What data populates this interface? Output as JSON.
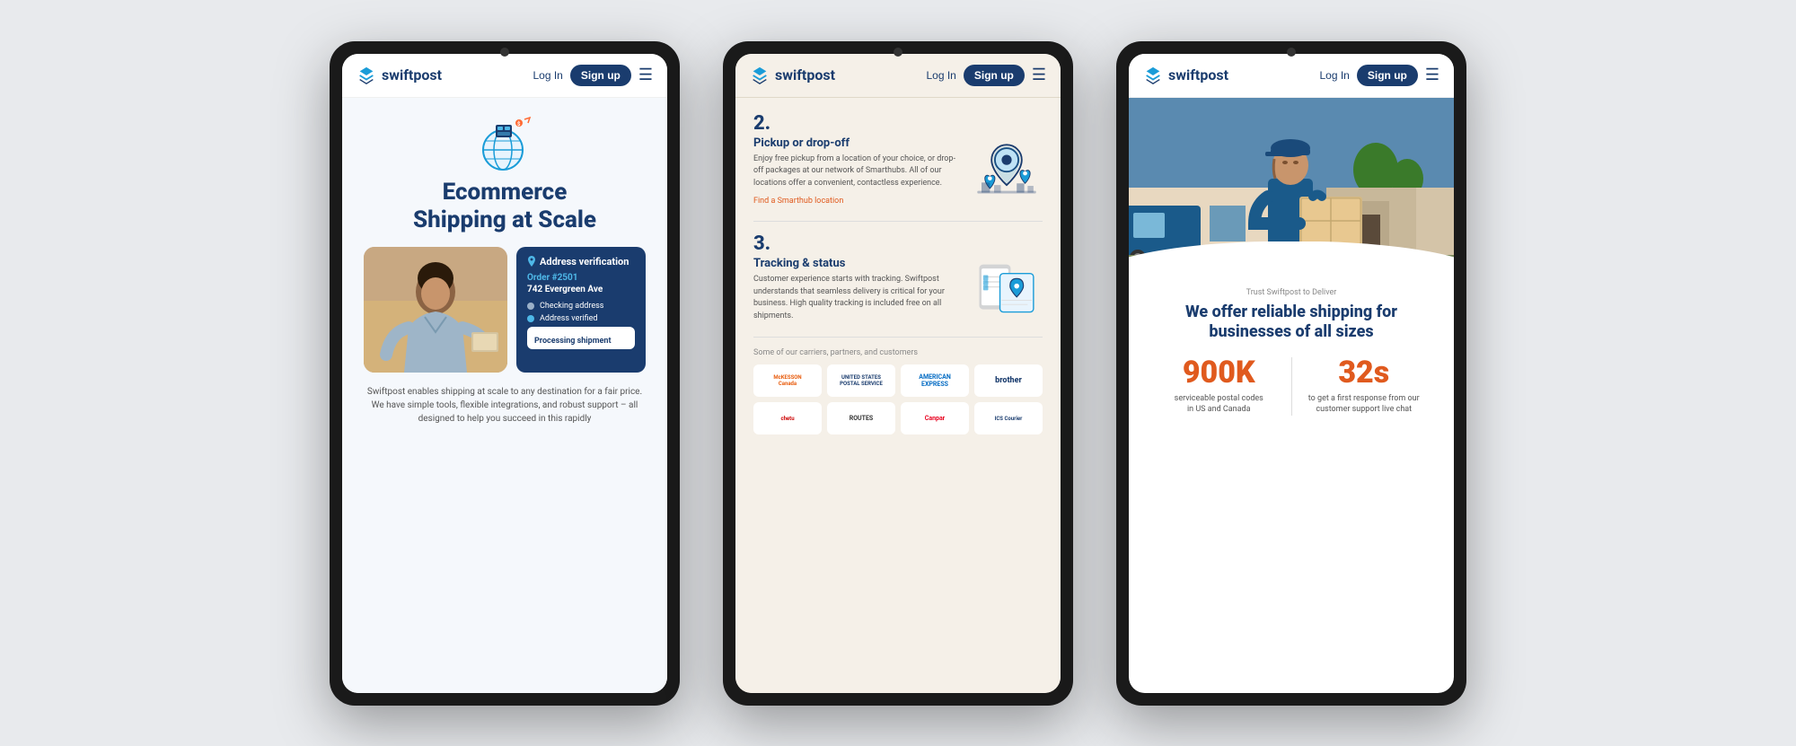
{
  "page": {
    "bg_color": "#e8eaed"
  },
  "tablet1": {
    "nav": {
      "logo_text": "swiftpost",
      "login": "Log In",
      "signup": "Sign up"
    },
    "hero": {
      "title_line1": "Ecommerce",
      "title_line2": "Shipping at Scale"
    },
    "address_card": {
      "title": "Address verification",
      "order": "Order #2501",
      "street": "742 Evergreen Ave",
      "step1": "Checking address",
      "step2": "Address verified",
      "step3": "Processing shipment"
    },
    "description": "Swiftpost enables shipping at scale to any destination for a fair price. We have simple tools, flexible integrations, and robust support – all designed to help you succeed in this rapidly"
  },
  "tablet2": {
    "nav": {
      "logo_text": "swiftpost",
      "login": "Log In",
      "signup": "Sign up"
    },
    "section2": {
      "number": "2.",
      "title": "Pickup or drop-off",
      "description": "Enjoy free pickup from a location of your choice, or drop-off packages at our network of Smarthubs. All of our locations offer a convenient, contactless experience.",
      "link": "Find a Smarthub location"
    },
    "section3": {
      "number": "3.",
      "title": "Tracking & status",
      "description": "Customer experience starts with tracking. Swiftpost understands that seamless delivery is critical for your business. High quality tracking is included free on all shipments."
    },
    "partners": {
      "label": "Some of our carriers, partners, and customers",
      "logos": [
        {
          "name": "McKesson Canada",
          "class": "logo-mckesson",
          "display": "McKESSON\nCanada"
        },
        {
          "name": "United States Postal Service",
          "class": "logo-usps",
          "display": "UNITED STATES\nPOSTAL SERVICE"
        },
        {
          "name": "American Express",
          "class": "logo-amex",
          "display": "AMERICAN\nEXPRESS"
        },
        {
          "name": "Brother",
          "class": "logo-brother",
          "display": "brother"
        },
        {
          "name": "Chetu",
          "class": "logo-chetu",
          "display": "chetu"
        },
        {
          "name": "Routes",
          "class": "logo-routes",
          "display": "ROUTES"
        },
        {
          "name": "Canpar",
          "class": "logo-canpar",
          "display": "Canpar"
        },
        {
          "name": "ICS Courier",
          "class": "logo-ics",
          "display": "ICS Courier"
        }
      ]
    }
  },
  "tablet3": {
    "nav": {
      "logo_text": "swiftpost",
      "login": "Log In",
      "signup": "Sign up"
    },
    "trust_text": "Trust Swiftpost to Deliver",
    "main_title": "We offer reliable shipping for businesses of all sizes",
    "stat1": {
      "number": "900K",
      "description": "serviceable postal codes\nin US and Canada"
    },
    "stat2": {
      "number": "32s",
      "description": "to get a first response from our\ncustomer support live chat"
    }
  }
}
